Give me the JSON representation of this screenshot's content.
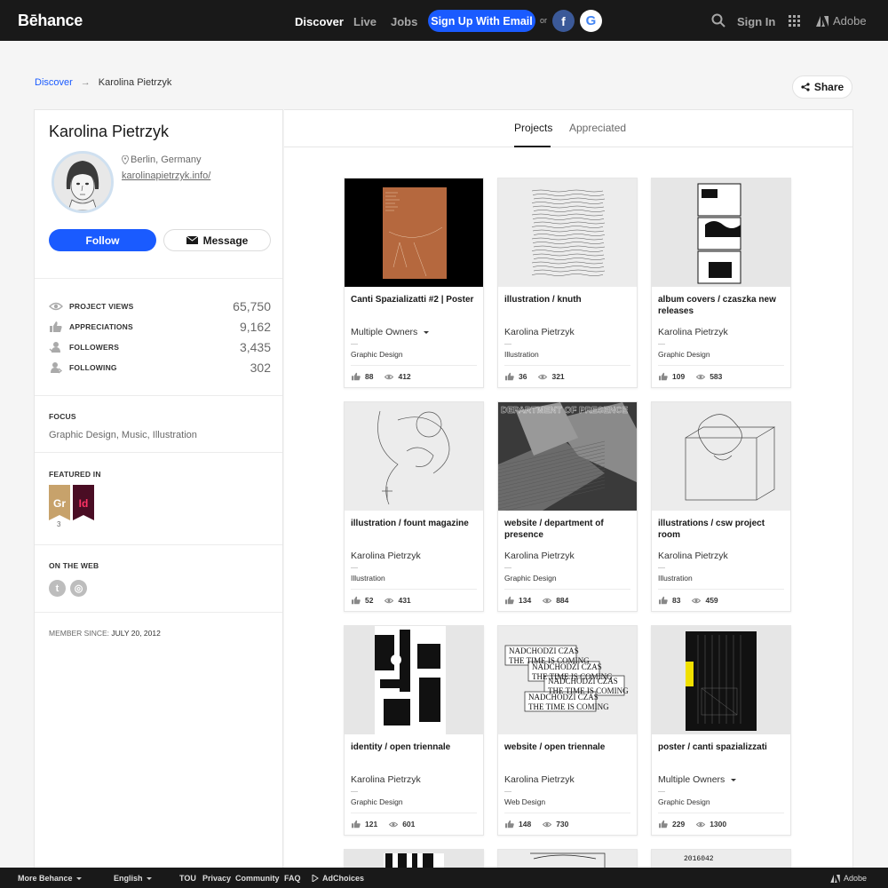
{
  "topnav": {
    "logo": "Bēhance",
    "discover": "Discover",
    "live": "Live",
    "jobs": "Jobs",
    "signup": "Sign Up With Email",
    "or": "or",
    "facebook_glyph": "f",
    "google_glyph": "G",
    "signin": "Sign In",
    "adobe": "Adobe"
  },
  "breadcrumb": {
    "discover": "Discover",
    "separator": "→",
    "current": "Karolina Pietrzyk"
  },
  "share_label": "Share",
  "profile": {
    "name": "Karolina Pietrzyk",
    "location": "Berlin, Germany",
    "website": "karolinapietrzyk.info/",
    "follow_label": "Follow",
    "message_label": "Message"
  },
  "stats": [
    {
      "label": "PROJECT VIEWS",
      "value": "65,750",
      "icon": "eye-icon"
    },
    {
      "label": "APPRECIATIONS",
      "value": "9,162",
      "icon": "thumbs-up-icon"
    },
    {
      "label": "FOLLOWERS",
      "value": "3,435",
      "icon": "followers-icon"
    },
    {
      "label": "FOLLOWING",
      "value": "302",
      "icon": "following-icon"
    }
  ],
  "focus": {
    "title": "FOCUS",
    "text": "Graphic Design, Music, Illustration"
  },
  "featured": {
    "title": "FEATURED IN",
    "badge1": "Gr",
    "badge2": "Id",
    "count": "3"
  },
  "on_the_web": {
    "title": "ON THE WEB",
    "icon1": "t",
    "icon2": "◎"
  },
  "member_since": {
    "label": "MEMBER SINCE: ",
    "date": "JULY 20, 2012"
  },
  "tabs": {
    "projects": "Projects",
    "appreciated": "Appreciated"
  },
  "projects": [
    {
      "title": "Canti Spazializatti #2 | Poster",
      "owner": "Multiple Owners",
      "field": "Graphic Design",
      "likes": "88",
      "views": "412"
    },
    {
      "title": "illustration / knuth",
      "owner": "Karolina Pietrzyk",
      "field": "Illustration",
      "likes": "36",
      "views": "321"
    },
    {
      "title": "album covers / czaszka new releases",
      "owner": "Karolina Pietrzyk",
      "field": "Graphic Design",
      "likes": "109",
      "views": "583"
    },
    {
      "title": "illustration / fount magazine",
      "owner": "Karolina Pietrzyk",
      "field": "Illustration",
      "likes": "52",
      "views": "431"
    },
    {
      "title": "website / department of presence",
      "owner": "Karolina Pietrzyk",
      "field": "Graphic Design",
      "likes": "134",
      "views": "884"
    },
    {
      "title": "illustrations / csw project room",
      "owner": "Karolina Pietrzyk",
      "field": "Illustration",
      "likes": "83",
      "views": "459"
    },
    {
      "title": "identity / open triennale",
      "owner": "Karolina Pietrzyk",
      "field": "Graphic Design",
      "likes": "121",
      "views": "601"
    },
    {
      "title": "website / open triennale",
      "owner": "Karolina Pietrzyk",
      "field": "Web Design",
      "likes": "148",
      "views": "730"
    },
    {
      "title": "poster / canti spazializzati",
      "owner": "Multiple Owners",
      "field": "Graphic Design",
      "likes": "229",
      "views": "1300"
    }
  ],
  "thumb_text": {
    "department": "DEPARTMENT OF PRESENCE",
    "nadchodzi": "NADCHODZI CZAS",
    "coming": "THE TIME IS COMING",
    "wste": "2016042"
  },
  "footer": {
    "more_behance": "More Behance",
    "english": "English",
    "tou": "TOU",
    "privacy": "Privacy",
    "community": "Community",
    "faq": "FAQ",
    "adchoices": "AdChoices",
    "adobe": "Adobe"
  },
  "colors": {
    "brand_blue": "#1a5bff",
    "nav_bg": "#191919"
  }
}
